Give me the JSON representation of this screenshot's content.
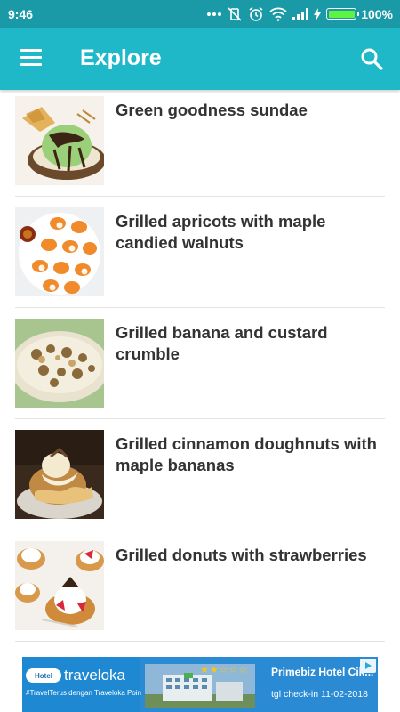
{
  "status_bar": {
    "time": "9:46",
    "battery_percent": "100%",
    "icons": [
      "more-dots-icon",
      "vibrate-off-icon",
      "alarm-icon",
      "wifi-icon",
      "signal-icon",
      "charging-icon",
      "battery-icon"
    ]
  },
  "app_bar": {
    "title": "Explore",
    "menu_icon": "menu-icon",
    "search_icon": "search-icon"
  },
  "colors": {
    "status_bar": "#199aa6",
    "app_bar": "#1fb8c8",
    "title_text": "#333333",
    "divider": "#e3e3e3",
    "ad_background": "#2a8bd4"
  },
  "recipes": [
    {
      "title": "Green goodness sundae",
      "image": "green-sundae-photo"
    },
    {
      "title": "Grilled apricots with maple candied walnuts",
      "image": "grilled-apricots-photo"
    },
    {
      "title": "Grilled banana and custard crumble",
      "image": "banana-crumble-photo"
    },
    {
      "title": "Grilled cinnamon doughnuts with maple bananas",
      "image": "cinnamon-doughnuts-photo"
    },
    {
      "title": "Grilled donuts with strawberries",
      "image": "donuts-strawberries-photo"
    }
  ],
  "ad": {
    "hotel_label": "Hotel",
    "brand": "traveloka",
    "tagline": "#TravelTerus dengan Traveloka Poin",
    "headline": "Primebiz Hotel Cik...",
    "details": "tgl check-in 11-02-2018",
    "stars": "★★☆☆☆"
  }
}
